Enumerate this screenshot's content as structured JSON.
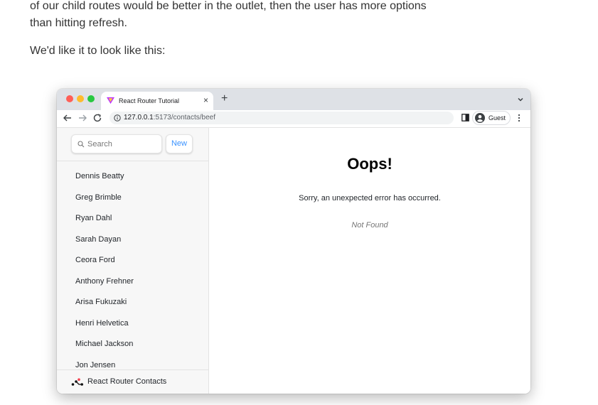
{
  "article": {
    "para1": "of our child routes would be better in the outlet, then the user has more options than hitting refresh.",
    "para2": "We'd like it to look like this:"
  },
  "browser": {
    "tab_title": "React Router Tutorial",
    "tab_close": "×",
    "new_tab": "+",
    "url_host": "127.0.0.1",
    "url_path": ":5173/contacts/beef",
    "profile_label": "Guest"
  },
  "sidebar": {
    "search_placeholder": "Search",
    "new_label": "New",
    "contacts": [
      "Dennis Beatty",
      "Greg Brimble",
      "Ryan Dahl",
      "Sarah Dayan",
      "Ceora Ford",
      "Anthony Frehner",
      "Arisa Fukuzaki",
      "Henri Helvetica",
      "Michael Jackson",
      "Jon Jensen"
    ],
    "footer": "React Router Contacts"
  },
  "error_page": {
    "title": "Oops!",
    "message": "Sorry, an unexpected error has occurred.",
    "status": "Not Found"
  },
  "colors": {
    "accent": "#3992ff",
    "tabstrip": "#dee1e6",
    "sidebar_bg": "#f7f7f7"
  }
}
